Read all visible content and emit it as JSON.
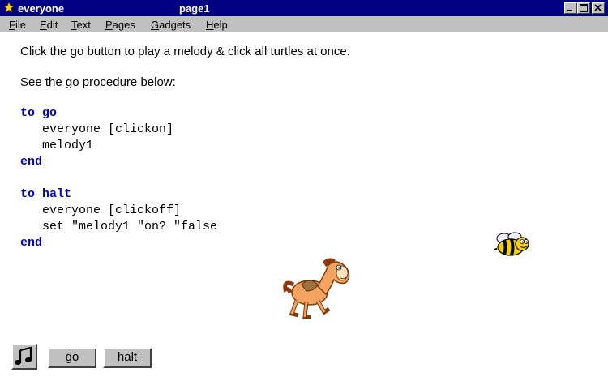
{
  "window": {
    "title": "everyone",
    "page": "page1"
  },
  "menu": {
    "file": "File",
    "edit": "Edit",
    "text": "Text",
    "pages": "Pages",
    "gadgets": "Gadgets",
    "help": "Help"
  },
  "content": {
    "intro1": "Click the go button to play a melody & click all turtles at once.",
    "intro2": "See the go procedure below:"
  },
  "code": {
    "line1_kw": "to go",
    "line2": "   everyone [clickon]",
    "line3": "   melody1",
    "line4_kw": "end",
    "line6_kw": "to halt",
    "line7": "   everyone [clickoff]",
    "line8": "   set \"melody1 \"on? \"false",
    "line9_kw": "end"
  },
  "buttons": {
    "go": "go",
    "halt": "halt"
  },
  "icons": {
    "app": "star-icon",
    "music": "music-note-icon",
    "horse": "horse-turtle-icon",
    "bee": "bee-turtle-icon"
  },
  "colors": {
    "titlebar": "#000080",
    "keyword": "#0000c0",
    "face": "#c0c0c0"
  }
}
